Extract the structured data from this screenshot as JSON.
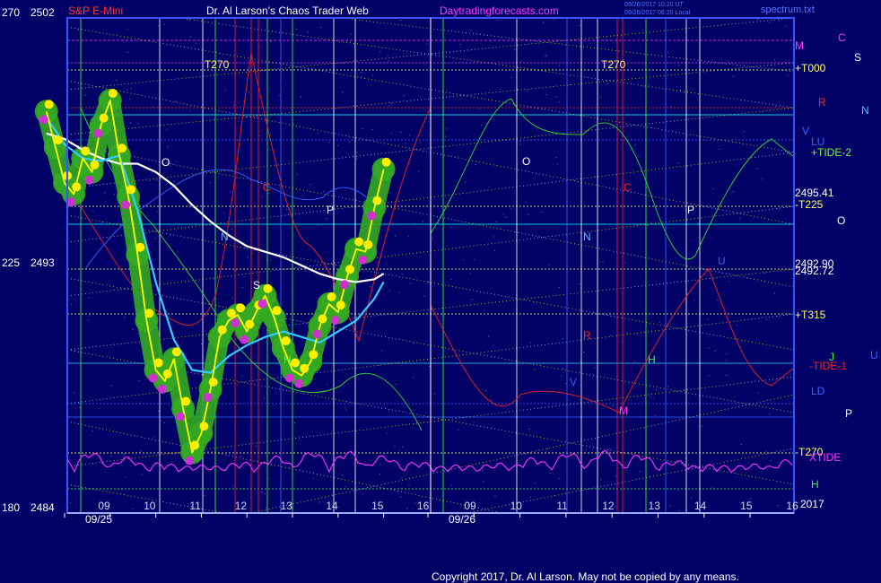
{
  "header": {
    "left_scale_top": "270",
    "price_top": "2502",
    "symbol": "S&P E-Mini",
    "title": "Dr. Al Larson's Chaos Trader Web",
    "site": "Daytradingforecasts.com",
    "file": "spectrum.txt",
    "timestamp_line1": "09/26/2017 10:20 UT",
    "timestamp_line2": "09/26/2017 06:20 Local"
  },
  "left_axis": [
    {
      "scale": "270",
      "price": "2502"
    },
    {
      "scale": "225",
      "price": "2493"
    },
    {
      "scale": "180",
      "price": "2484"
    }
  ],
  "x_ticks_day1": [
    "09",
    "10",
    "11",
    "12",
    "13",
    "14",
    "15",
    "16"
  ],
  "x_ticks_day2": [
    "09",
    "10",
    "11",
    "12",
    "13",
    "14",
    "15",
    "16"
  ],
  "dates": [
    "09/25",
    "09/26"
  ],
  "right_labels": [
    {
      "text": "M",
      "color": "#ff33ff"
    },
    {
      "text": "C",
      "color": "#ff33ff"
    },
    {
      "text": "S",
      "color": "#ffffff"
    },
    {
      "text": "+T000",
      "color": "#ffff66"
    },
    {
      "text": "R",
      "color": "#ff2222"
    },
    {
      "text": "N",
      "color": "#33ccff"
    },
    {
      "text": "V",
      "color": "#3366ff"
    },
    {
      "text": "LU",
      "color": "#3366ff"
    },
    {
      "text": "+TIDE-2",
      "color": "#66ff33"
    },
    {
      "text": "2495.41",
      "color": "#ffffff"
    },
    {
      "text": "-T225",
      "color": "#ffff66"
    },
    {
      "text": "O",
      "color": "#ffffff"
    },
    {
      "text": "2492.90",
      "color": "#ffffff"
    },
    {
      "text": "2492.72",
      "color": "#ffffff"
    },
    {
      "text": "+T315",
      "color": "#ffff66"
    },
    {
      "text": "J",
      "color": "#33ff33"
    },
    {
      "text": "U",
      "color": "#3366ff"
    },
    {
      "text": "-TIDE-1",
      "color": "#ff2222"
    },
    {
      "text": "LD",
      "color": "#3366ff"
    },
    {
      "text": "P",
      "color": "#ffffff"
    },
    {
      "text": "-T270",
      "color": "#ffff66"
    },
    {
      "text": "XTIDE",
      "color": "#ff33ff"
    },
    {
      "text": "H",
      "color": "#33ff33"
    },
    {
      "text": "2017",
      "color": "#ffffff"
    }
  ],
  "chart_labels": [
    {
      "text": "T270",
      "color": "#ffff66"
    },
    {
      "text": "T270",
      "color": "#ffff66"
    },
    {
      "text": "O",
      "color": "#ffffff"
    },
    {
      "text": "O",
      "color": "#ffffff"
    },
    {
      "text": "C",
      "color": "#ff2222"
    },
    {
      "text": "C",
      "color": "#ff2222"
    },
    {
      "text": "N",
      "color": "#33ccff"
    },
    {
      "text": "N",
      "color": "#33ccff"
    },
    {
      "text": "P",
      "color": "#ffffff"
    },
    {
      "text": "P",
      "color": "#ffffff"
    },
    {
      "text": "S",
      "color": "#ffffff"
    },
    {
      "text": "H",
      "color": "#33ff33"
    },
    {
      "text": "H",
      "color": "#33ff33"
    },
    {
      "text": "M",
      "color": "#ff33ff"
    },
    {
      "text": "R",
      "color": "#ff2222"
    },
    {
      "text": "V",
      "color": "#3366ff"
    },
    {
      "text": "U",
      "color": "#3366ff"
    }
  ],
  "footer": "Copyright 2017, Dr. Al Larson. May not be copied by any means.",
  "colors": {
    "background": "#000066",
    "frame": "#3355ff",
    "price": "#ffff00",
    "price_glow": "#33aa22",
    "turns": "#ffee00",
    "lows": "#cc33cc",
    "avg_fast": "#33ccff",
    "avg_slow": "#ffffff",
    "tide_green": "#33dd33",
    "tide_red": "#ee2222",
    "spectrum": "#ff33ff",
    "guide": "#ffff66"
  },
  "chart_data": {
    "type": "line",
    "symbol": "S&P E-Mini",
    "ylim": [
      2484,
      2502
    ],
    "scale_ylim": [
      180,
      270
    ],
    "x_hours_day1": [
      9,
      10,
      11,
      12,
      13,
      14,
      15,
      16
    ],
    "series": [
      {
        "name": "S&P E-Mini",
        "x": [
          8.6,
          8.8,
          9.0,
          9.2,
          9.4,
          9.6,
          9.8,
          10.0,
          10.2,
          10.4,
          10.6,
          10.8,
          11.0,
          11.2,
          11.4,
          11.6,
          11.8,
          12.0,
          12.2,
          12.4,
          12.6,
          12.8,
          13.0,
          13.2,
          13.4,
          13.6,
          13.8,
          14.0,
          14.2,
          14.4,
          14.6,
          14.8,
          15.0,
          15.2,
          15.4,
          15.6,
          15.8,
          16.0
        ],
        "y": [
          2498.6,
          2497.3,
          2496.0,
          2495.6,
          2496.9,
          2496.4,
          2498.1,
          2499.0,
          2497.0,
          2495.5,
          2493.4,
          2491.0,
          2489.2,
          2488.8,
          2489.6,
          2487.8,
          2486.2,
          2486.9,
          2488.5,
          2490.4,
          2491.0,
          2491.2,
          2490.6,
          2491.3,
          2491.9,
          2491.1,
          2490.0,
          2489.2,
          2489.0,
          2489.5,
          2490.8,
          2491.6,
          2491.3,
          2492.6,
          2493.6,
          2493.5,
          2495.1,
          2496.5
        ]
      },
      {
        "name": "fast average",
        "x": [
          8.6,
          9.0,
          9.4,
          9.8,
          10.2,
          10.6,
          11.0,
          11.4,
          11.8,
          12.2,
          12.6,
          13.0,
          13.4,
          13.8,
          14.2,
          14.6,
          15.0,
          15.4,
          15.8,
          16.0
        ],
        "y": [
          2498.4,
          2497.4,
          2496.9,
          2496.8,
          2497.0,
          2495.0,
          2492.4,
          2490.3,
          2489.2,
          2489.1,
          2489.7,
          2490.1,
          2490.4,
          2490.6,
          2490.4,
          2490.2,
          2490.6,
          2491.0,
          2491.8,
          2492.4
        ]
      },
      {
        "name": "slow average",
        "x": [
          8.6,
          9.0,
          9.4,
          9.8,
          10.2,
          10.6,
          11.0,
          11.4,
          11.8,
          12.2,
          12.6,
          13.0,
          13.4,
          13.8,
          14.2,
          14.6,
          15.0,
          15.4,
          15.8,
          16.0
        ],
        "y": [
          2497.8,
          2497.6,
          2497.2,
          2496.9,
          2496.7,
          2496.7,
          2496.4,
          2495.9,
          2495.2,
          2494.6,
          2494.1,
          2493.7,
          2493.5,
          2493.3,
          2493.0,
          2492.7,
          2492.5,
          2492.4,
          2492.5,
          2492.7
        ]
      }
    ]
  }
}
